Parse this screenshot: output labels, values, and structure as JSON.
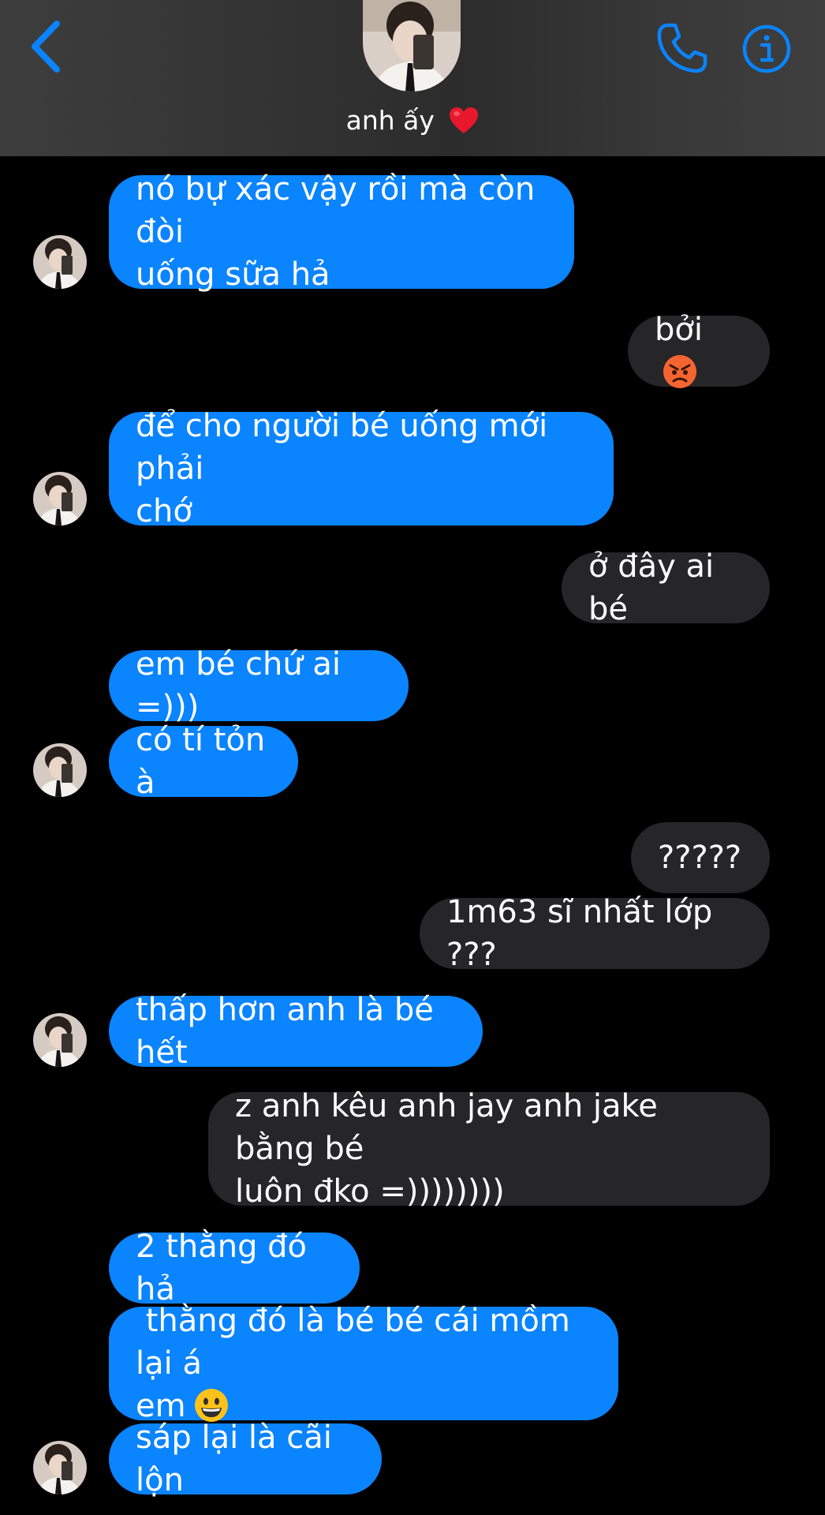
{
  "header": {
    "contact_name": "anh ấy",
    "name_emoji": "red-heart-emoji",
    "back_icon": "chevron-left-icon",
    "call_icon": "phone-icon",
    "info_icon": "info-icon"
  },
  "colors": {
    "accent": "#0a84ff",
    "incoming_bubble": "#0a84ff",
    "outgoing_bubble": "#262628",
    "background": "#000000",
    "header_bg": "#363636"
  },
  "messages": [
    {
      "from": "them",
      "text": "nó bự xác vậy rồi mà còn đòi\nuống sữa hả"
    },
    {
      "from": "me",
      "text": "bởi",
      "emoji": "angry-face-emoji"
    },
    {
      "from": "them",
      "text": "để cho người bé uống mới phải\nchớ"
    },
    {
      "from": "me",
      "text": "ở đây ai bé"
    },
    {
      "from": "them",
      "text": "em bé chứ ai =)))"
    },
    {
      "from": "them",
      "text": "có tí tỏn à"
    },
    {
      "from": "me",
      "text": "?????"
    },
    {
      "from": "me",
      "text": "1m63 sĩ nhất lớp ???"
    },
    {
      "from": "them",
      "text": "thấp hơn anh là bé hết"
    },
    {
      "from": "me",
      "text": "z anh kêu anh jay anh jake bằng bé\nluôn đko =))))))))"
    },
    {
      "from": "them",
      "text": "2 thằng đó hả"
    },
    {
      "from": "them",
      "text": " thằng đó là bé bé cái mồm lại á\nem",
      "emoji": "grinning-face-emoji"
    },
    {
      "from": "them",
      "text": "sáp lại là cãi lộn"
    }
  ]
}
